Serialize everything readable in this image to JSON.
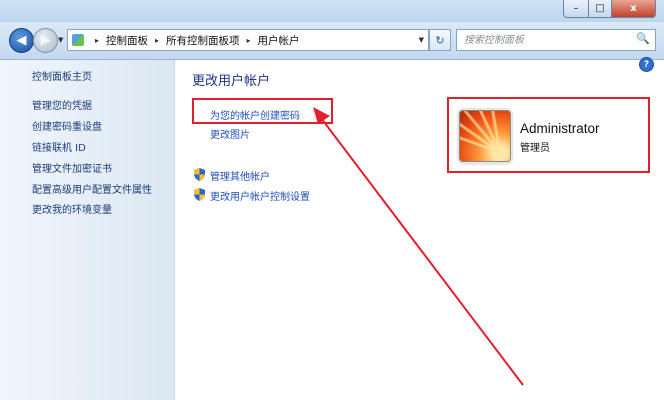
{
  "window": {
    "min_glyph": "–",
    "max_glyph": "□",
    "close_glyph": "x"
  },
  "nav": {
    "back_glyph": "◀",
    "forward_glyph": "▶",
    "refresh_glyph": "↻"
  },
  "address": {
    "crumbs": [
      "控制面板",
      "所有控制面板项",
      "用户帐户"
    ],
    "separator": "▸"
  },
  "search": {
    "placeholder": "搜索控制面板"
  },
  "sidebar": {
    "items": [
      {
        "label": "控制面板主页"
      },
      {
        "label": "管理您的凭据"
      },
      {
        "label": "创建密码重设盘"
      },
      {
        "label": "链接联机 ID"
      },
      {
        "label": "管理文件加密证书"
      },
      {
        "label": "配置高级用户配置文件属性"
      },
      {
        "label": "更改我的环境变量"
      }
    ]
  },
  "main": {
    "title": "更改用户帐户",
    "links": [
      {
        "label": "为您的帐户创建密码"
      },
      {
        "label": "更改图片"
      }
    ],
    "admin_links": [
      {
        "label": "管理其他帐户"
      },
      {
        "label": "更改用户帐户控制设置"
      }
    ]
  },
  "account": {
    "name": "Administrator",
    "role": "管理员"
  },
  "help": {
    "glyph": "?"
  },
  "colors": {
    "annotation": "#e0202a",
    "link": "#1f4fbf",
    "title": "#1e3287"
  },
  "icons": {
    "control_panel": "control-panel-icon",
    "shield": "uac-shield-icon",
    "search": "search-icon",
    "refresh": "refresh-icon"
  }
}
